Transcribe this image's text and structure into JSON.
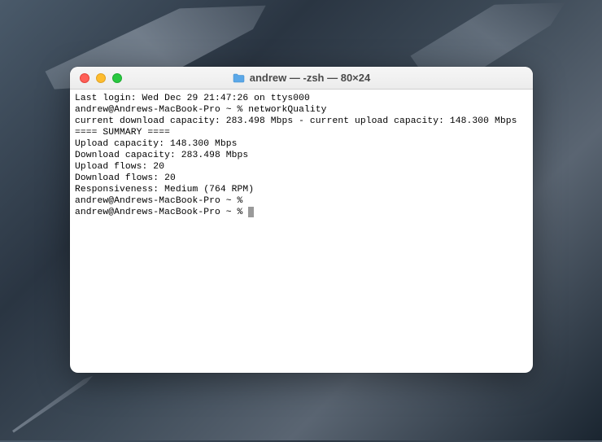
{
  "window": {
    "title": "andrew — -zsh — 80×24"
  },
  "terminal": {
    "lines": [
      "Last login: Wed Dec 29 21:47:26 on ttys000",
      "andrew@Andrews-MacBook-Pro ~ % networkQuality",
      "current download capacity: 283.498 Mbps - current upload capacity: 148.300 Mbps",
      "==== SUMMARY ====",
      "",
      "Upload capacity: 148.300 Mbps",
      "Download capacity: 283.498 Mbps",
      "Upload flows: 20",
      "Download flows: 20",
      "Responsiveness: Medium (764 RPM)",
      "andrew@Andrews-MacBook-Pro ~ % ",
      "andrew@Andrews-MacBook-Pro ~ % "
    ]
  }
}
